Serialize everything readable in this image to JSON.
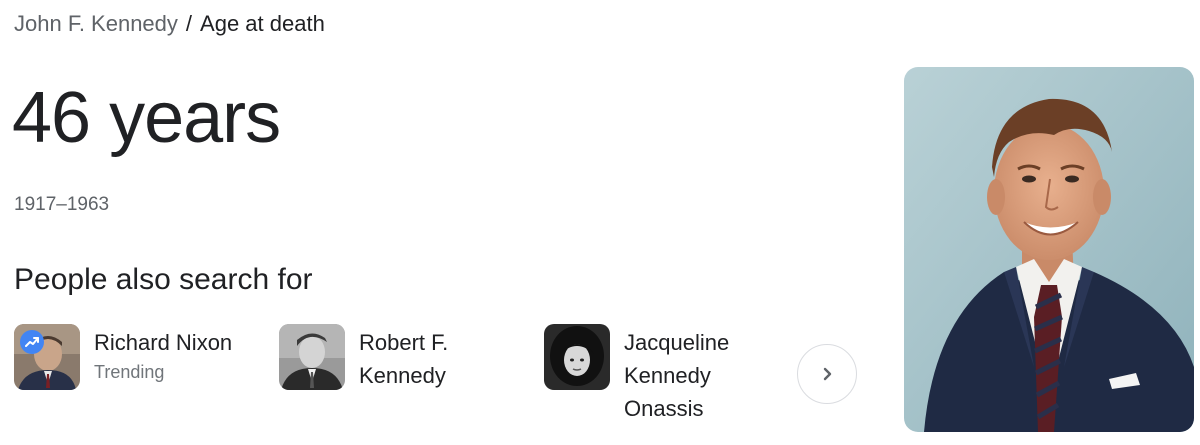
{
  "breadcrumb": {
    "parent": "John F. Kennedy",
    "separator": "/",
    "current": "Age at death"
  },
  "answer": "46 years",
  "dates": "1917–1963",
  "people_also_search_for": {
    "title": "People also search for",
    "items": [
      {
        "name": "Richard Nixon",
        "subtitle": "Trending",
        "trending": true
      },
      {
        "name_lines": [
          "Robert F.",
          "Kennedy"
        ]
      },
      {
        "name_lines": [
          "Jacqueline",
          "Kennedy",
          "Onassis"
        ]
      }
    ]
  },
  "colors": {
    "badge_blue": "#4285f4",
    "muted_text": "#5f6368",
    "subtitle_text": "#70757a"
  },
  "icons": {
    "trending": "trending-up-icon",
    "next": "chevron-right-icon"
  }
}
